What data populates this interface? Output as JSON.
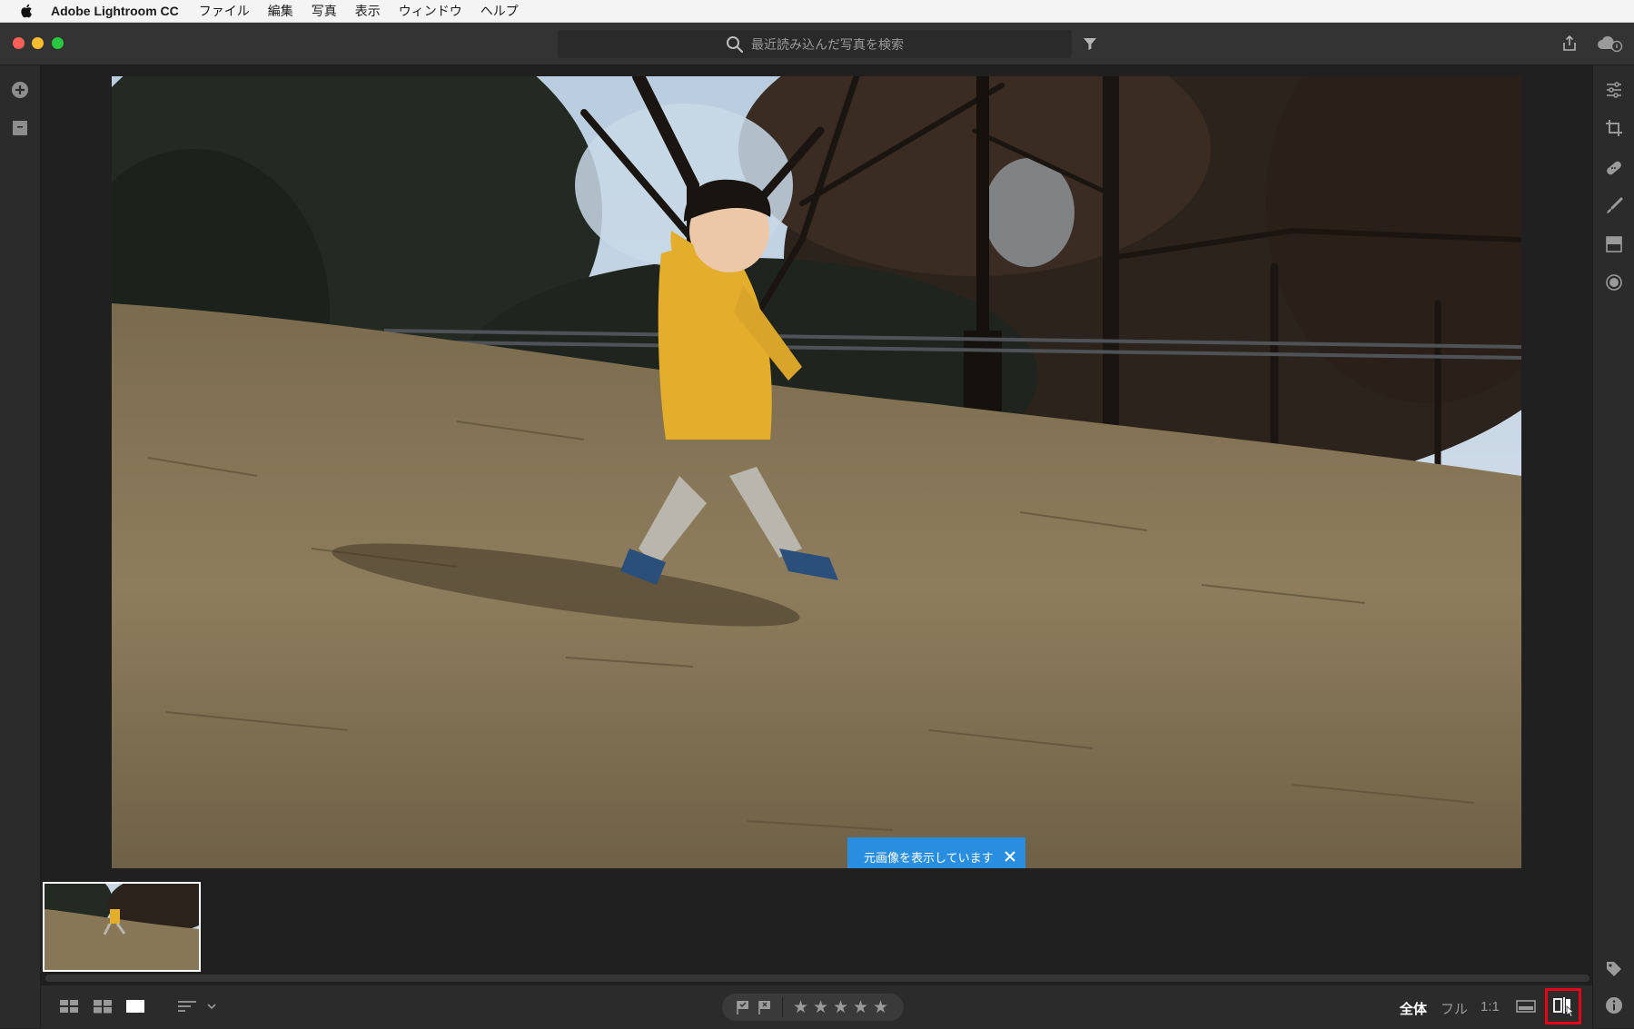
{
  "menubar": {
    "app_name": "Adobe Lightroom CC",
    "items": [
      "ファイル",
      "編集",
      "写真",
      "表示",
      "ウィンドウ",
      "ヘルプ"
    ]
  },
  "search": {
    "placeholder": "最近読み込んだ写真を検索"
  },
  "toast": {
    "message": "元画像を表示しています"
  },
  "zoom": {
    "fit": "全体",
    "fill": "フル",
    "one_to_one": "1:1"
  },
  "colors": {
    "accent": "#2a8ee0",
    "highlight": "#e3051a"
  },
  "icons": {
    "left_panel": [
      "add-photos-icon",
      "albums-icon"
    ],
    "right_panel": [
      "edit-sliders-icon",
      "crop-icon",
      "healing-brush-icon",
      "brush-icon",
      "linear-gradient-icon",
      "radial-gradient-icon",
      "keyword-tag-icon",
      "info-icon"
    ],
    "bottom_left": [
      "square-grid-icon",
      "photo-grid-icon",
      "detail-view-icon",
      "sort-icon"
    ],
    "bottom_right": [
      "filmstrip-icon",
      "compare-before-after-icon"
    ]
  }
}
